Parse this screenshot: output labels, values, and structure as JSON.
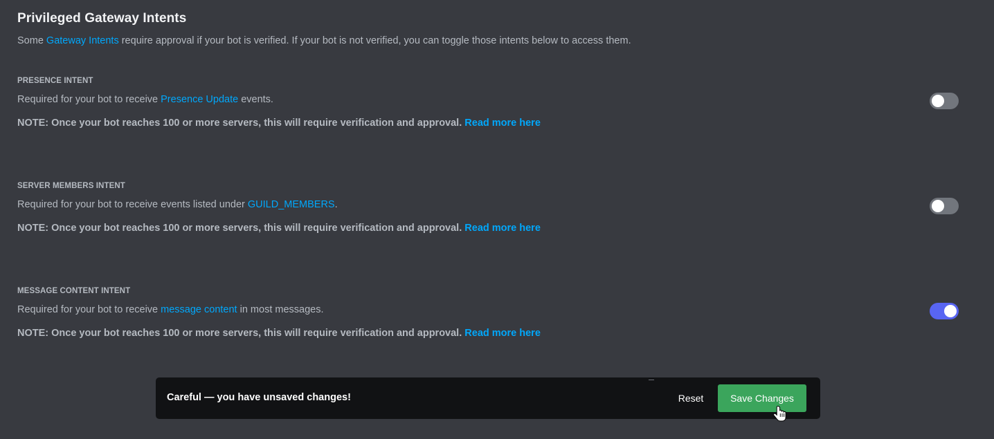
{
  "section": {
    "title": "Privileged Gateway Intents",
    "desc_before": "Some ",
    "desc_link": "Gateway Intents",
    "desc_after": " require approval if your bot is verified. If your bot is not verified, you can toggle those intents below to access them."
  },
  "intents": [
    {
      "title": "PRESENCE INTENT",
      "desc_before": "Required for your bot to receive ",
      "desc_link": "Presence Update",
      "desc_after": " events.",
      "note": "NOTE: Once your bot reaches 100 or more servers, this will require verification and approval.",
      "note_link": "Read more here",
      "enabled": false
    },
    {
      "title": "SERVER MEMBERS INTENT",
      "desc_before": "Required for your bot to receive events listed under ",
      "desc_link": "GUILD_MEMBERS",
      "desc_after": ".",
      "note": "NOTE: Once your bot reaches 100 or more servers, this will require verification and approval.",
      "note_link": "Read more here",
      "enabled": false
    },
    {
      "title": "MESSAGE CONTENT INTENT",
      "desc_before": "Required for your bot to receive ",
      "desc_link": "message content",
      "desc_after": " in most messages.",
      "note": "NOTE: Once your bot reaches 100 or more servers, this will require verification and approval.",
      "note_link": "Read more here",
      "enabled": true
    }
  ],
  "notice": {
    "text": "Careful — you have unsaved changes!",
    "reset_label": "Reset",
    "save_label": "Save Changes"
  },
  "colors": {
    "background": "#383a40",
    "link": "#00a8fc",
    "toggle_on": "#5865f2",
    "toggle_off": "#72767d",
    "save_button": "#3ba55c",
    "notice_bar": "#111214"
  }
}
